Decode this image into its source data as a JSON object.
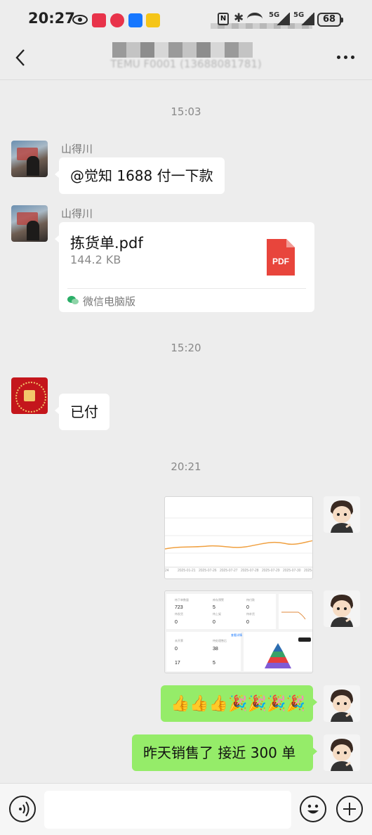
{
  "status_bar": {
    "time": "20:27",
    "nfc_label": "N",
    "net1": "5G",
    "net2": "5G",
    "battery": "68"
  },
  "header": {
    "title": "",
    "subtitle": "TEMU F0001 (13688081781)"
  },
  "messages": {
    "ts1": "15:03",
    "m1_sender": "山得川",
    "m1_text": "@觉知  1688 付一下款",
    "m2_sender": "山得川",
    "file": {
      "name": "拣货单.pdf",
      "size": "144.2 KB",
      "icon_label": "PDF",
      "source": "微信电脑版"
    },
    "ts2": "15:20",
    "m3_text": "已付",
    "ts3": "20:21",
    "m6_emojis": [
      "👍",
      "👍",
      "👍",
      "🎉",
      "🎉",
      "🎉",
      "🎉"
    ],
    "m7_text": "昨天销售了 接近 300 单"
  },
  "shot1": {
    "ticks": [
      "24",
      "2025-01-21",
      "2025-07-26",
      "2025-07-27",
      "2025-07-28",
      "2025-07-29",
      "2025-07-30",
      "2025-07"
    ]
  },
  "shot2": {
    "labels": [
      "待下单数量",
      "库存预警",
      "待付款",
      "待发货",
      "待上架",
      "待补货",
      "未开票",
      "待处理售后"
    ],
    "values": [
      "723",
      "5",
      "0",
      "0",
      "0",
      "0",
      "0",
      "38",
      "17",
      "5"
    ],
    "link": "查看详情"
  },
  "icons": {
    "back": "chevron-left-icon",
    "more": "more-dots-icon",
    "voice": "voice-icon",
    "emoji": "smiley-icon",
    "plus": "plus-circle-icon",
    "pdf": "pdf-file-icon",
    "wechat": "wechat-icon"
  },
  "colors": {
    "background": "#ededed",
    "bubble_green": "#95ec69",
    "bubble_white": "#ffffff",
    "pdf_red": "#e8453c"
  }
}
